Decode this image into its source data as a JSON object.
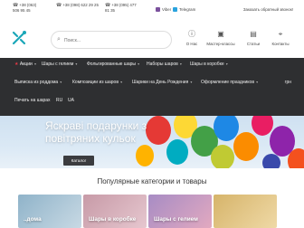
{
  "topbar": {
    "phones": [
      "+38 (063) 506 95 45",
      "+38 (098) 622 29 25",
      "+38 (095) 477 81 35"
    ],
    "viber_label": "Viber",
    "telegram_label": "Telegram",
    "callback_label": "Заказать обратный звонок!"
  },
  "header": {
    "search_placeholder": "Поиск...",
    "nav": [
      {
        "label": "О Нас",
        "icon": "info-icon"
      },
      {
        "label": "Мастер-классы",
        "icon": "presentation-icon"
      },
      {
        "label": "Статьи",
        "icon": "article-icon"
      },
      {
        "label": "Контакты",
        "icon": "location-icon"
      }
    ]
  },
  "menu": {
    "row1": [
      {
        "label": "Акции",
        "icon": "star-icon"
      },
      {
        "label": "Шары с гелием"
      },
      {
        "label": "Фольгированные шары"
      },
      {
        "label": "Наборы шаров"
      },
      {
        "label": "Шары в коробке"
      }
    ],
    "row2": [
      {
        "label": "Выписка из роддома"
      },
      {
        "label": "Композиции из шаров"
      },
      {
        "label": "Шарики на День Рождения"
      },
      {
        "label": "Оформление праздников"
      }
    ],
    "row3": [
      {
        "label": "Печать на шарах"
      },
      {
        "label": "RU"
      },
      {
        "label": "UA"
      }
    ],
    "currency": "грн"
  },
  "hero": {
    "title": "Яскраві подарунки з повітряних кульок",
    "button_label": "Каталог"
  },
  "section": {
    "title": "Популярные категории и товары",
    "cards": [
      {
        "label": "..дома"
      },
      {
        "label": "Шары в коробке"
      },
      {
        "label": "Шары с гелием"
      }
    ]
  },
  "colors": {
    "menu_bg": "#2e2f31",
    "accent_red": "#e63946",
    "viber": "#7b519d",
    "telegram": "#2aa3de"
  }
}
